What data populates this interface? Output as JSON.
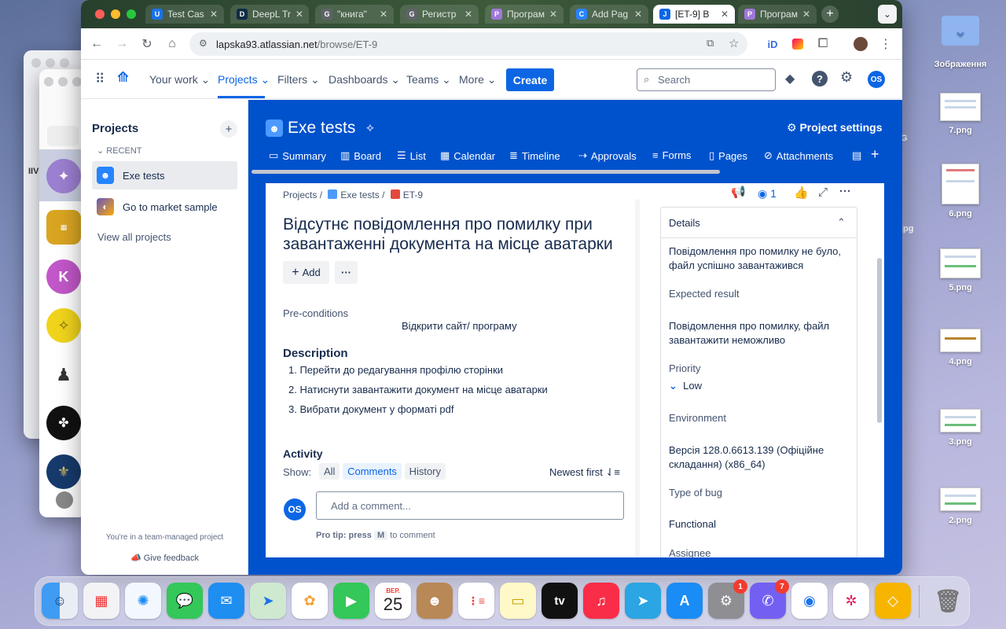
{
  "colors": {
    "jira_blue": "#0052cc",
    "accent": "#0c66e4",
    "chrome_frame": "#2b4330"
  },
  "desktop": {
    "folder_label": "Зображення",
    "files": [
      "7.png",
      "6.png",
      "5.png",
      "4.png",
      "3.png",
      "2.png"
    ],
    "partial_labels": [
      "G",
      "jpg"
    ]
  },
  "bg_window": {
    "partial_text": "IIV"
  },
  "tabs": [
    {
      "title": "Test Cas",
      "favicon": "U"
    },
    {
      "title": "DeepL Tr",
      "favicon": "D"
    },
    {
      "title": "\"книга\"",
      "favicon": "G"
    },
    {
      "title": "Регистр",
      "favicon": "G"
    },
    {
      "title": "Програм",
      "favicon": "P"
    },
    {
      "title": "Add Pag",
      "favicon": "C"
    },
    {
      "title": "[ET-9] В",
      "favicon": "J"
    },
    {
      "title": "Програм",
      "favicon": "P"
    }
  ],
  "address": {
    "host": "lapska93.atlassian.net",
    "path": "/browse/ET-9"
  },
  "jira_nav": {
    "items": [
      "Your work",
      "Projects",
      "Filters",
      "Dashboards",
      "Teams",
      "More"
    ],
    "create": "Create",
    "search_placeholder": "Search",
    "avatar": "OS"
  },
  "sidebar": {
    "title": "Projects",
    "recent_label": "RECENT",
    "projects": [
      "Exe tests",
      "Go to market sample"
    ],
    "view_all": "View all projects",
    "footer_note": "You're in a team-managed project",
    "feedback": "Give feedback"
  },
  "project": {
    "name": "Exe tests",
    "settings": "Project settings",
    "tabs": [
      "Summary",
      "Board",
      "List",
      "Calendar",
      "Timeline",
      "Approvals",
      "Forms",
      "Pages",
      "Attachments"
    ]
  },
  "issue": {
    "breadcrumb": [
      "Projects",
      "Exe tests",
      "ET-9"
    ],
    "title": "Відсутнє повідомлення про помилку при завантаженні документа на місце аватарки",
    "add_label": "Add",
    "more_label": "···",
    "preconditions_label": "Pre-conditions",
    "preconditions_value": "Відкрити сайт/ програму",
    "description_label": "Description",
    "steps": [
      "1. Перейти до редагування профілю сторінки",
      "2. Натиснути завантажити документ на місце аватарки",
      "3. Вибрати документ у форматі pdf"
    ],
    "activity_label": "Activity",
    "show_label": "Show:",
    "filters": [
      "All",
      "Comments",
      "History"
    ],
    "sort": "Newest first",
    "comment_placeholder": "Add a comment...",
    "commenter": "OS",
    "protip_prefix": "Pro tip: press",
    "protip_key": "M",
    "protip_suffix": "to comment",
    "watchers": "1"
  },
  "details": {
    "heading": "Details",
    "actual_value": "Повідомлення про помилку не було, файл успішно завантажився",
    "expected_label": "Expected result",
    "expected_value": "Повідомлення про помилку, файл завантажити неможливо",
    "priority_label": "Priority",
    "priority_value": "Low",
    "environment_label": "Environment",
    "environment_value": "Версія 128.0.6613.139 (Офіційне складання) (x86_64)",
    "bug_type_label": "Type of bug",
    "bug_type_value": "Functional",
    "assignee_label": "Assignee"
  },
  "slack_workspaces": [
    "",
    "",
    "K",
    "",
    "",
    "",
    "",
    ""
  ],
  "dock": {
    "calendar_month": "ВЕР.",
    "calendar_day": "25",
    "tv_label": "tv",
    "badges": {
      "settings": "1",
      "viber": "7"
    }
  }
}
